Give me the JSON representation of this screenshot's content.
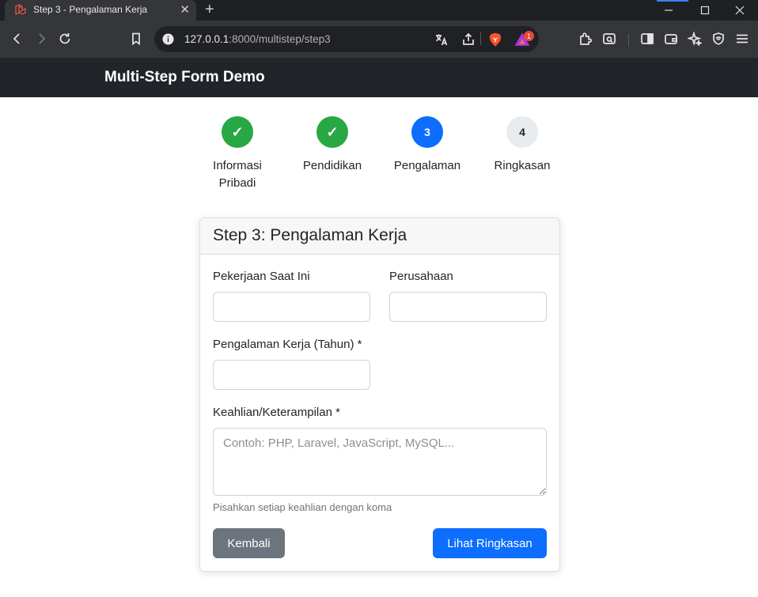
{
  "browser": {
    "tab_title": "Step 3 - Pengalaman Kerja",
    "url_host": "127.0.0.1",
    "url_rest": ":8000/multistep/step3",
    "notification_count": "1",
    "new_tab_symbol": "+",
    "close_symbol": "✕"
  },
  "navbar": {
    "brand": "Multi-Step Form Demo"
  },
  "stepper": {
    "steps": [
      {
        "marker": "✓",
        "label": "Informasi Pribadi",
        "state": "done"
      },
      {
        "marker": "✓",
        "label": "Pendidikan",
        "state": "done"
      },
      {
        "marker": "3",
        "label": "Pengalaman",
        "state": "active"
      },
      {
        "marker": "4",
        "label": "Ringkasan",
        "state": "pending"
      }
    ]
  },
  "form": {
    "title": "Step 3: Pengalaman Kerja",
    "current_job_label": "Pekerjaan Saat Ini",
    "current_job_value": "",
    "company_label": "Perusahaan",
    "company_value": "",
    "experience_label": "Pengalaman Kerja (Tahun) *",
    "experience_value": "",
    "skills_label": "Keahlian/Keterampilan *",
    "skills_placeholder": "Contoh: PHP, Laravel, JavaScript, MySQL...",
    "skills_help": "Pisahkan setiap keahlian dengan koma",
    "back_button": "Kembali",
    "next_button": "Lihat Ringkasan"
  },
  "colors": {
    "step_done": "#28a745",
    "step_active": "#0d6efd",
    "step_pending": "#e9ecef",
    "navbar_bg": "#212529",
    "btn_secondary": "#6c757d",
    "btn_primary": "#0d6efd"
  }
}
